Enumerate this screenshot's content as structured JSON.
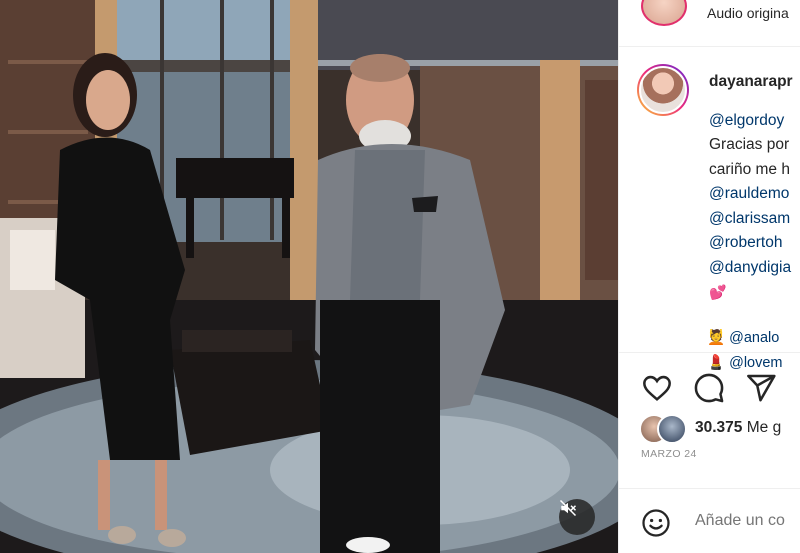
{
  "audio": {
    "label": "Audio origina"
  },
  "post": {
    "username": "dayanarapr",
    "caption_lines": [
      {
        "text": "@elgordoy",
        "type": "mention"
      },
      {
        "text": "Gracias por",
        "type": "text"
      },
      {
        "text": "cariño me h",
        "type": "text"
      },
      {
        "text": "@rauldemo",
        "type": "mention"
      },
      {
        "text": "@clarissam",
        "type": "mention"
      },
      {
        "text": "@robertoh",
        "type": "mention"
      },
      {
        "text": "@danydigia",
        "type": "mention"
      }
    ],
    "heart_emoji": "💕",
    "tagged_lines": [
      {
        "emoji": "💆",
        "text": "@analo"
      },
      {
        "emoji": "💄",
        "text": "@lovem"
      }
    ]
  },
  "actions": {
    "like_icon": "heart-icon",
    "comment_icon": "comment-icon",
    "share_icon": "send-icon"
  },
  "likes": {
    "count": "30.375",
    "label": "Me g"
  },
  "date": "MARZO 24",
  "comment": {
    "placeholder": "Añade un co",
    "emoji_icon": "emoji-icon"
  },
  "video": {
    "mute_icon": "speaker-muted-icon"
  },
  "colors": {
    "mention": "#00376b",
    "text": "#262626",
    "muted": "#8e8e8e",
    "story_ring": "#ee2a7b"
  }
}
